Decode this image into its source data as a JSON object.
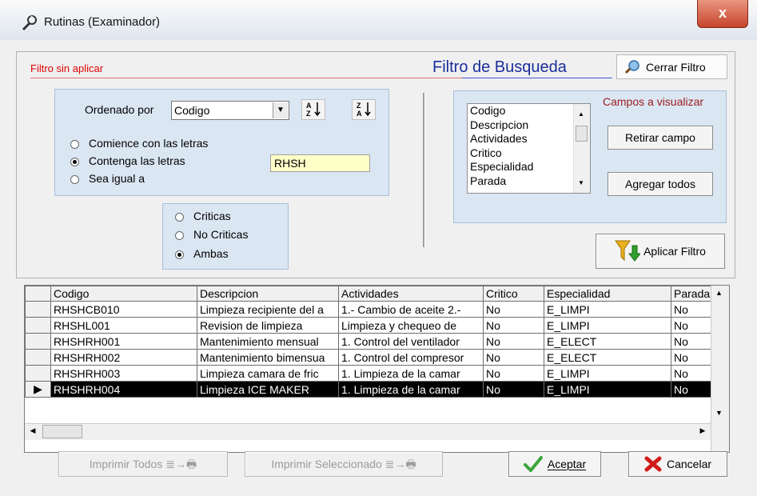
{
  "window": {
    "title": "Rutinas (Examinador)",
    "close_label": "x"
  },
  "filter": {
    "status": "Filtro sin aplicar",
    "title": "Filtro de Busqueda",
    "close_filter_label": "Cerrar Filtro",
    "ordered_by_label": "Ordenado por",
    "ordered_by_value": "Codigo",
    "sort_asc_label": "A\nZ",
    "sort_desc_label": "Z\nA",
    "match_options": [
      {
        "label": "Comience con las letras",
        "selected": false
      },
      {
        "label": "Contenga las letras",
        "selected": true
      },
      {
        "label": "Sea igual a",
        "selected": false
      }
    ],
    "search_value": "RHSH",
    "critical_options": [
      {
        "label": "Criticas",
        "selected": false
      },
      {
        "label": "No Criticas",
        "selected": false
      },
      {
        "label": "Ambas",
        "selected": true
      }
    ],
    "fields_label": "Campos a visualizar",
    "fields": [
      "Codigo",
      "Descripcion",
      "Actividades",
      "Critico",
      "Especialidad",
      "Parada"
    ],
    "remove_field_label": "Retirar campo",
    "add_all_label": "Agregar todos",
    "apply_filter_label": "Aplicar Filtro"
  },
  "grid": {
    "columns": [
      "Codigo",
      "Descripcion",
      "Actividades",
      "Critico",
      "Especialidad",
      "Parada"
    ],
    "rows": [
      [
        "RHSHCB010",
        "Limpieza recipiente del a",
        "1.- Cambio de aceite 2.-",
        "No",
        "E_LIMPI",
        "No"
      ],
      [
        "RHSHL001",
        "Revision de limpieza",
        "Limpieza y chequeo de",
        "No",
        "E_LIMPI",
        "No"
      ],
      [
        "RHSHRH001",
        "Mantenimiento mensual",
        "1. Control del ventilador",
        "No",
        "E_ELECT",
        "No"
      ],
      [
        "RHSHRH002",
        "Mantenimiento bimensua",
        "1. Control del compresor",
        "No",
        "E_ELECT",
        "No"
      ],
      [
        "RHSHRH003",
        "Limpieza  camara de fric",
        "1. Limpieza de la camar",
        "No",
        "E_LIMPI",
        "No"
      ],
      [
        "RHSHRH004",
        "Limpieza  ICE MAKER",
        "1. Limpieza de la camar",
        "No",
        "E_LIMPI",
        "No"
      ]
    ],
    "selected_row": 5
  },
  "footer": {
    "print_all_label": "Imprimir Todos",
    "print_selected_label": "Imprimir Seleccionado",
    "accept_label": "Aceptar",
    "cancel_label": "Cancelar"
  }
}
